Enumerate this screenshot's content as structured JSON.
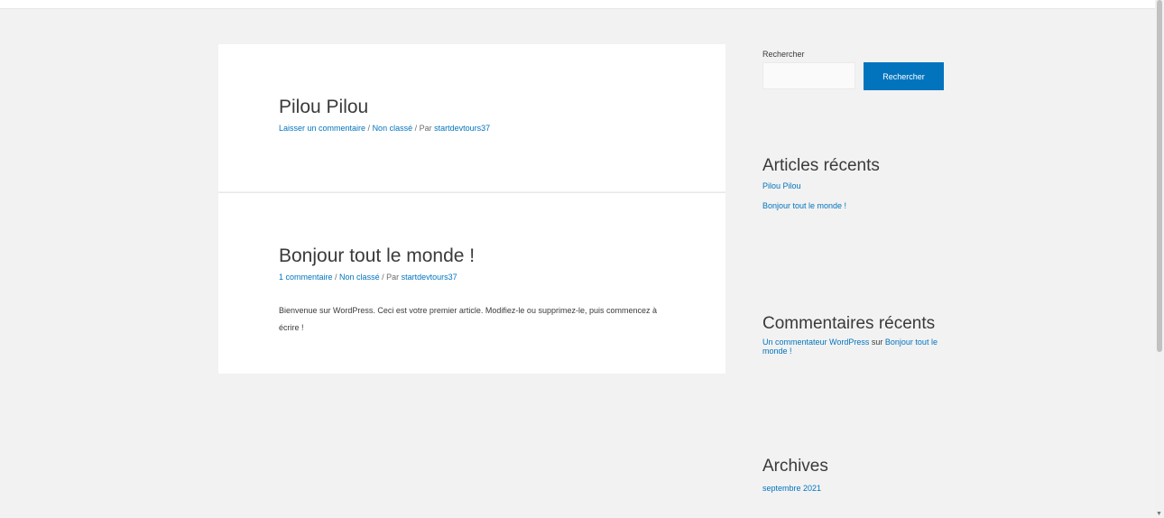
{
  "posts": [
    {
      "title": "Pilou Pilou",
      "comments_link": "Laisser un commentaire",
      "sep1": " / ",
      "category": "Non classé",
      "sep2": " / Par ",
      "author": "startdevtours37"
    },
    {
      "title": "Bonjour tout le monde !",
      "comments_link": "1 commentaire",
      "sep1": " / ",
      "category": "Non classé",
      "sep2": " / Par ",
      "author": "startdevtours37",
      "excerpt": "Bienvenue sur WordPress. Ceci est votre premier article. Modifiez-le ou supprimez-le, puis commencez à écrire !"
    }
  ],
  "sidebar": {
    "search": {
      "label": "Rechercher",
      "input_value": "",
      "button_label": "Rechercher"
    },
    "recent_posts": {
      "title": "Articles récents",
      "items": [
        "Pilou Pilou",
        "Bonjour tout le monde !"
      ]
    },
    "recent_comments": {
      "title": "Commentaires récents",
      "author": "Un commentateur WordPress",
      "on_text": " sur ",
      "post": "Bonjour tout le monde !"
    },
    "archives": {
      "title": "Archives",
      "items": [
        "septembre 2021"
      ]
    }
  },
  "colors": {
    "accent": "#0274be",
    "background": "#f2f2f2",
    "card": "#ffffff",
    "text": "#3a3a3a"
  }
}
